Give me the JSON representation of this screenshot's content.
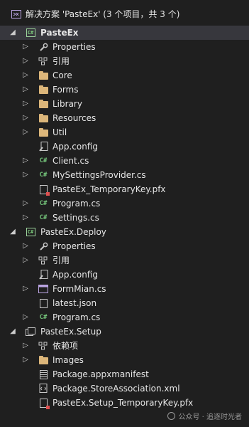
{
  "solution_header": {
    "label": "解决方案 'PasteEx' (3 个项目，共 3 个)"
  },
  "tree": [
    {
      "label": "PasteEx",
      "depth": 0,
      "arrow": "expanded",
      "icon": "csharp-project-icon",
      "bold": true,
      "selected": true
    },
    {
      "label": "Properties",
      "depth": 1,
      "arrow": "collapsed",
      "icon": "wrench-icon"
    },
    {
      "label": "引用",
      "depth": 1,
      "arrow": "collapsed",
      "icon": "references-icon"
    },
    {
      "label": "Core",
      "depth": 1,
      "arrow": "collapsed",
      "icon": "folder-icon"
    },
    {
      "label": "Forms",
      "depth": 1,
      "arrow": "collapsed",
      "icon": "folder-icon"
    },
    {
      "label": "Library",
      "depth": 1,
      "arrow": "collapsed",
      "icon": "folder-icon"
    },
    {
      "label": "Resources",
      "depth": 1,
      "arrow": "collapsed",
      "icon": "folder-icon"
    },
    {
      "label": "Util",
      "depth": 1,
      "arrow": "collapsed",
      "icon": "folder-icon"
    },
    {
      "label": "App.config",
      "depth": 1,
      "arrow": "none",
      "icon": "config-file-icon"
    },
    {
      "label": "Client.cs",
      "depth": 1,
      "arrow": "collapsed",
      "icon": "csharp-file-icon"
    },
    {
      "label": "MySettingsProvider.cs",
      "depth": 1,
      "arrow": "collapsed",
      "icon": "csharp-file-icon"
    },
    {
      "label": "PasteEx_TemporaryKey.pfx",
      "depth": 1,
      "arrow": "none",
      "icon": "certificate-file-icon"
    },
    {
      "label": "Program.cs",
      "depth": 1,
      "arrow": "collapsed",
      "icon": "csharp-file-icon"
    },
    {
      "label": "Settings.cs",
      "depth": 1,
      "arrow": "collapsed",
      "icon": "csharp-file-icon"
    },
    {
      "label": "PasteEx.Deploy",
      "depth": 0,
      "arrow": "expanded",
      "icon": "csharp-project-icon"
    },
    {
      "label": "Properties",
      "depth": 1,
      "arrow": "collapsed",
      "icon": "wrench-icon"
    },
    {
      "label": "引用",
      "depth": 1,
      "arrow": "collapsed",
      "icon": "references-icon"
    },
    {
      "label": "App.config",
      "depth": 1,
      "arrow": "none",
      "icon": "config-file-icon"
    },
    {
      "label": "FormMian.cs",
      "depth": 1,
      "arrow": "collapsed",
      "icon": "form-file-icon"
    },
    {
      "label": "latest.json",
      "depth": 1,
      "arrow": "none",
      "icon": "json-file-icon"
    },
    {
      "label": "Program.cs",
      "depth": 1,
      "arrow": "collapsed",
      "icon": "csharp-file-icon"
    },
    {
      "label": "PasteEx.Setup",
      "depth": 0,
      "arrow": "expanded",
      "icon": "package-project-icon"
    },
    {
      "label": "依赖项",
      "depth": 1,
      "arrow": "collapsed",
      "icon": "references-icon"
    },
    {
      "label": "Images",
      "depth": 1,
      "arrow": "collapsed",
      "icon": "folder-icon"
    },
    {
      "label": "Package.appxmanifest",
      "depth": 1,
      "arrow": "none",
      "icon": "manifest-file-icon"
    },
    {
      "label": "Package.StoreAssociation.xml",
      "depth": 1,
      "arrow": "none",
      "icon": "xml-file-icon"
    },
    {
      "label": "PasteEx.Setup_TemporaryKey.pfx",
      "depth": 1,
      "arrow": "none",
      "icon": "certificate-file-icon"
    }
  ],
  "watermark": {
    "text": "公众号 · 追逐时光者"
  }
}
